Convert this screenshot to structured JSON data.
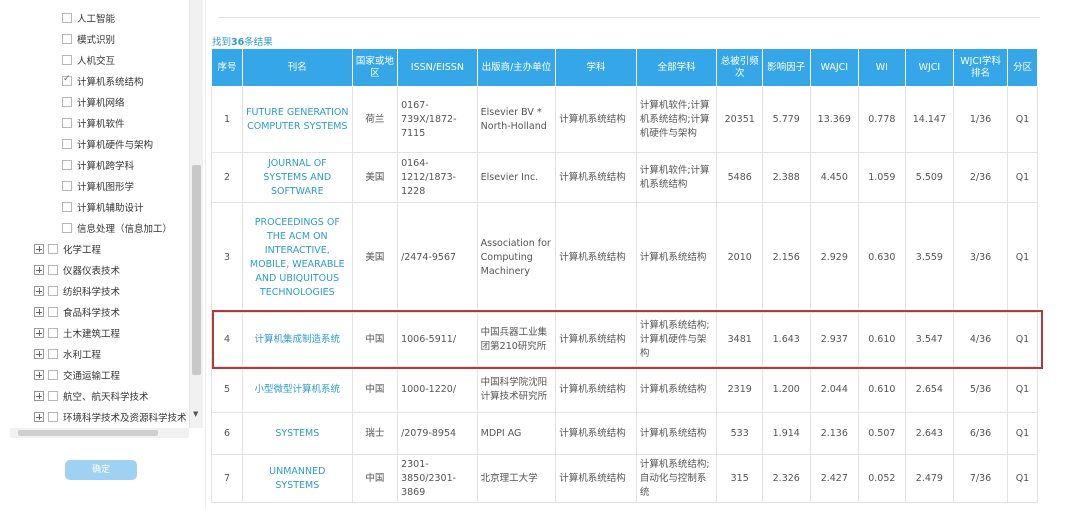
{
  "tree": {
    "items": [
      {
        "label": "人工智能",
        "type": "child",
        "checked": false
      },
      {
        "label": "模式识别",
        "type": "child",
        "checked": false
      },
      {
        "label": "人机交互",
        "type": "child",
        "checked": false
      },
      {
        "label": "计算机系统结构",
        "type": "child",
        "checked": true
      },
      {
        "label": "计算机网络",
        "type": "child",
        "checked": false
      },
      {
        "label": "计算机软件",
        "type": "child",
        "checked": false
      },
      {
        "label": "计算机硬件与架构",
        "type": "child",
        "checked": false
      },
      {
        "label": "计算机跨学科",
        "type": "child",
        "checked": false
      },
      {
        "label": "计算机图形学",
        "type": "child",
        "checked": false
      },
      {
        "label": "计算机辅助设计",
        "type": "child",
        "checked": false
      },
      {
        "label": "信息处理（信息加工）",
        "type": "child",
        "checked": false
      },
      {
        "label": "化学工程",
        "type": "parent"
      },
      {
        "label": "仪器仪表技术",
        "type": "parent"
      },
      {
        "label": "纺织科学技术",
        "type": "parent"
      },
      {
        "label": "食品科学技术",
        "type": "parent"
      },
      {
        "label": "土木建筑工程",
        "type": "parent"
      },
      {
        "label": "水利工程",
        "type": "parent"
      },
      {
        "label": "交通运输工程",
        "type": "parent"
      },
      {
        "label": "航空、航天科学技术",
        "type": "parent"
      },
      {
        "label": "环境科学技术及资源科学技术",
        "type": "parent"
      }
    ]
  },
  "confirm_label": "确定",
  "results": {
    "prefix": "找到",
    "count": "36",
    "suffix": "条结果"
  },
  "table": {
    "headers": [
      "序号",
      "刊名",
      "国家或地区",
      "ISSN/EISSN",
      "出版商/主办单位",
      "学科",
      "全部学科",
      "总被引频次",
      "影响因子",
      "WAJCI",
      "WI",
      "WJCI",
      "WJCI学科排名",
      "分区"
    ],
    "rows": [
      [
        "1",
        "FUTURE GENERATION COMPUTER SYSTEMS",
        "荷兰",
        "0167-739X/1872-7115",
        "Elsevier BV * North-Holland",
        "计算机系统结构",
        "计算机软件;计算机系统结构;计算机硬件与架构",
        "20351",
        "5.779",
        "13.369",
        "0.778",
        "14.147",
        "1/36",
        "Q1"
      ],
      [
        "2",
        "JOURNAL OF SYSTEMS AND SOFTWARE",
        "美国",
        "0164-1212/1873-1228",
        "Elsevier Inc.",
        "计算机系统结构",
        "计算机软件;计算机系统结构",
        "5486",
        "2.388",
        "4.450",
        "1.059",
        "5.509",
        "2/36",
        "Q1"
      ],
      [
        "3",
        "PROCEEDINGS OF THE ACM ON INTERACTIVE, MOBILE, WEARABLE AND UBIQUITOUS TECHNOLOGIES",
        "美国",
        "/2474-9567",
        "Association for Computing Machinery",
        "计算机系统结构",
        "计算机系统结构",
        "2010",
        "2.156",
        "2.929",
        "0.630",
        "3.559",
        "3/36",
        "Q1"
      ],
      [
        "4",
        "计算机集成制造系统",
        "中国",
        "1006-5911/",
        "中国兵器工业集团第210研究所",
        "计算机系统结构",
        "计算机系统结构;计算机硬件与架构",
        "3481",
        "1.643",
        "2.937",
        "0.610",
        "3.547",
        "4/36",
        "Q1"
      ],
      [
        "5",
        "小型微型计算机系统",
        "中国",
        "1000-1220/",
        "中国科学院沈阳计算技术研究所",
        "计算机系统结构",
        "计算机系统结构",
        "2319",
        "1.200",
        "2.044",
        "0.610",
        "2.654",
        "5/36",
        "Q1"
      ],
      [
        "6",
        "SYSTEMS",
        "瑞士",
        "/2079-8954",
        "MDPI AG",
        "计算机系统结构",
        "计算机系统结构",
        "533",
        "1.914",
        "2.136",
        "0.507",
        "2.643",
        "6/36",
        "Q1"
      ],
      [
        "7",
        "UNMANNED SYSTEMS",
        "中国",
        "2301-3850/2301-3869",
        "北京理工大学",
        "计算机系统结构",
        "计算机系统结构;自动化与控制系统",
        "315",
        "2.326",
        "2.427",
        "0.052",
        "2.479",
        "7/36",
        "Q1"
      ]
    ],
    "highlighted_row": 4
  }
}
